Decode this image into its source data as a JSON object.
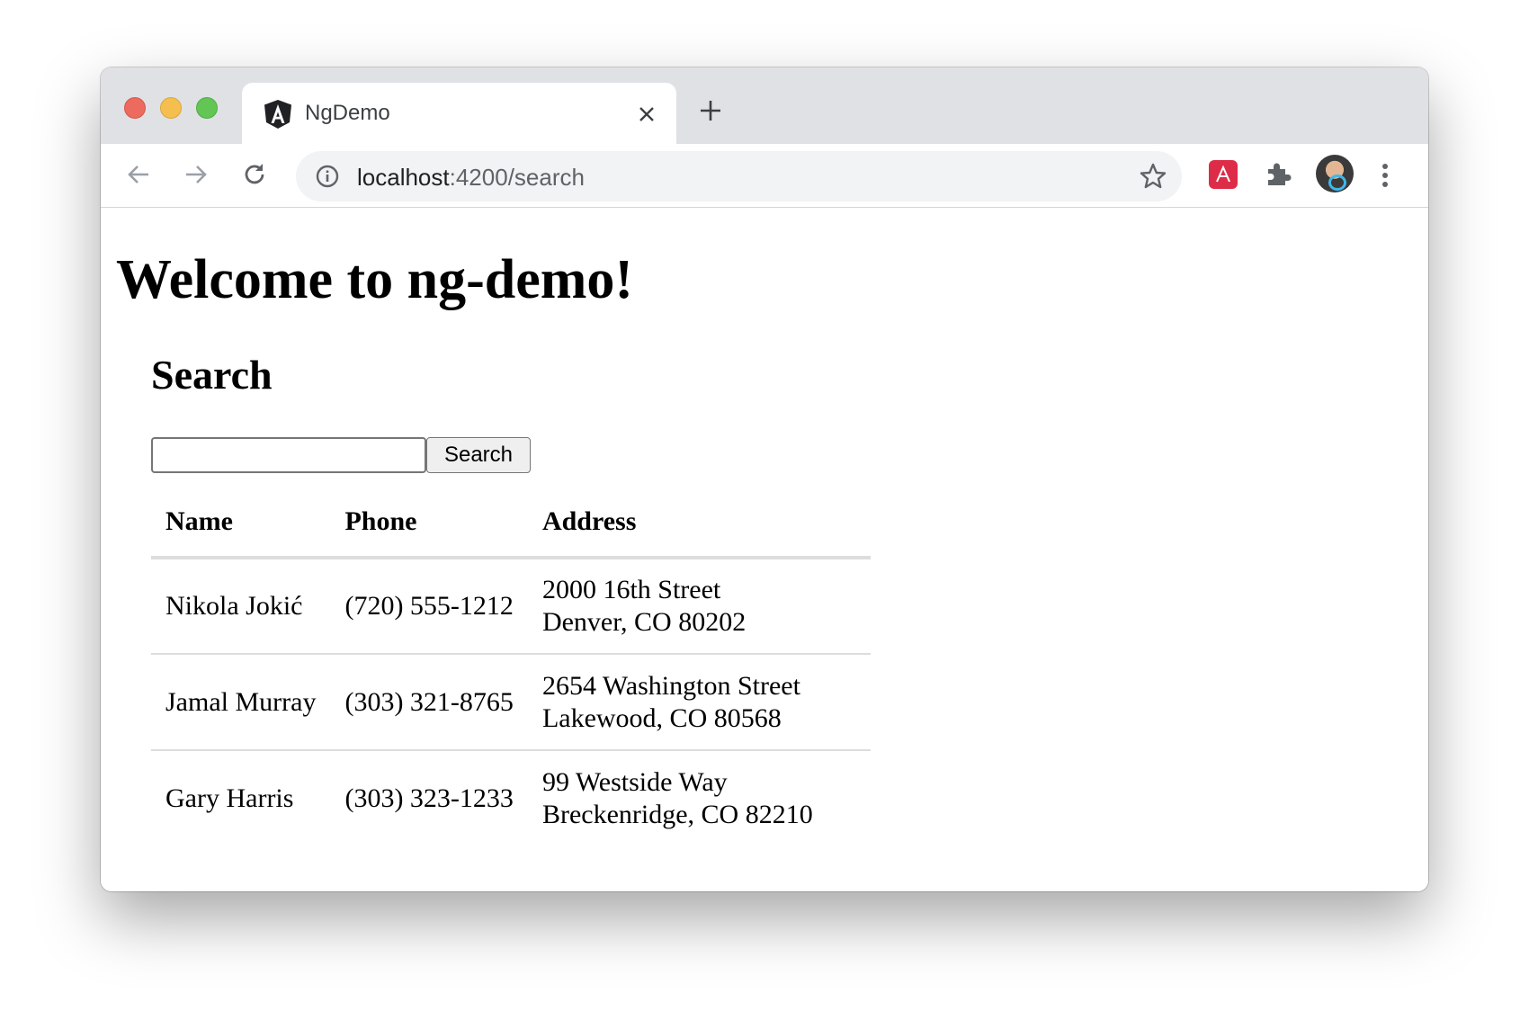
{
  "browser": {
    "tab": {
      "title": "NgDemo",
      "favicon": "angular-icon"
    },
    "url": {
      "host": "localhost",
      "path": ":4200/search"
    },
    "icons": {
      "back": "arrow-left-icon",
      "forward": "arrow-right-icon",
      "reload": "reload-icon",
      "info": "info-icon",
      "star": "star-icon",
      "extension_red": "a-extension-icon",
      "extensions": "puzzle-icon",
      "menu": "more-vert-icon"
    }
  },
  "page": {
    "heading": "Welcome to ng-demo!",
    "subheading": "Search",
    "search": {
      "value": "",
      "placeholder": "",
      "button_label": "Search"
    },
    "table": {
      "headers": [
        "Name",
        "Phone",
        "Address"
      ],
      "rows": [
        {
          "name": "Nikola Jokić",
          "phone": "(720) 555-1212",
          "address": [
            "2000 16th Street",
            "Denver, CO 80202"
          ]
        },
        {
          "name": "Jamal Murray",
          "phone": "(303) 321-8765",
          "address": [
            "2654 Washington Street",
            "Lakewood, CO 80568"
          ]
        },
        {
          "name": "Gary Harris",
          "phone": "(303) 323-1233",
          "address": [
            "99 Westside Way",
            "Breckenridge, CO 82210"
          ]
        }
      ]
    }
  },
  "colors": {
    "titlebar": "#dfe1e5",
    "omnibox": "#f1f3f4",
    "close": "#ed6a5e",
    "minimize": "#f5bf4f",
    "zoom": "#62c554",
    "extension_red": "#dd2c47"
  }
}
